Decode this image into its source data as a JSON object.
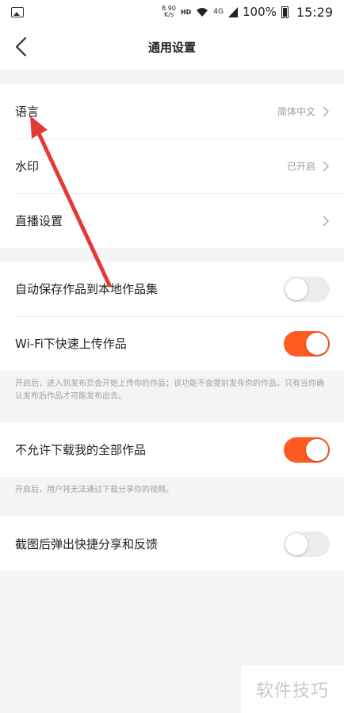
{
  "status_bar": {
    "net_speed_value": "8.90",
    "net_speed_unit": "K/s",
    "hd": "HD",
    "signal": "4G",
    "battery": "100%",
    "time": "15:29"
  },
  "header": {
    "title": "通用设置",
    "back_icon": "chevron-left-icon"
  },
  "group1": [
    {
      "label": "语言",
      "value": "简体中文"
    },
    {
      "label": "水印",
      "value": "已开启"
    },
    {
      "label": "直播设置",
      "value": ""
    }
  ],
  "group2": [
    {
      "label": "自动保存作品到本地作品集",
      "toggle": false
    },
    {
      "label": "Wi-Fi下快速上传作品",
      "toggle": true
    }
  ],
  "note1": "开启后，进入到发布页会开始上传你的作品；该功能不会提前发布你的作品，只有当你确认发布后作品才可能发布出去。",
  "group3": [
    {
      "label": "不允许下载我的全部作品",
      "toggle": true
    }
  ],
  "note2": "开启后，用户将无法通过下载分享你的视频。",
  "group4": [
    {
      "label": "截图后弹出快捷分享和反馈",
      "toggle": false
    }
  ],
  "watermark": "软件技巧",
  "colors": {
    "accent": "#ff5a1f",
    "annotation_arrow": "#e53935",
    "background": "#f4f4f4"
  }
}
